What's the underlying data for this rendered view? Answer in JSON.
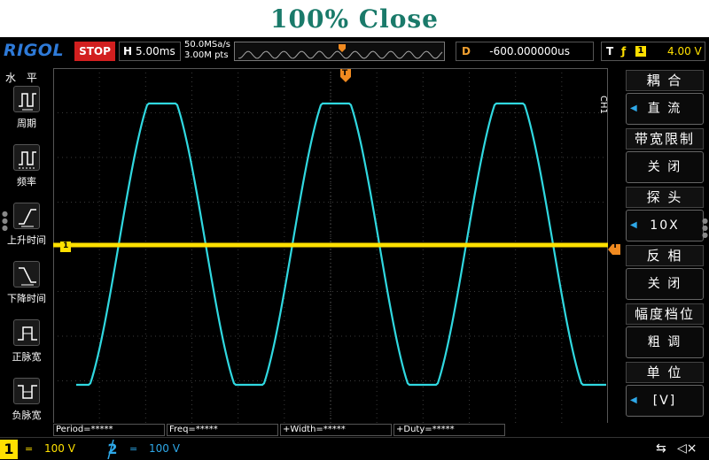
{
  "page": {
    "title": "100% Close"
  },
  "topbar": {
    "brand": "RIGOL",
    "run_state": "STOP",
    "timebase_tag": "H",
    "timebase": "5.00ms",
    "sample_rate": "50.0MSa/s",
    "memory_depth": "3.00M pts",
    "delay_tag": "D",
    "delay": "-600.000000us",
    "trigger_tag": "T",
    "trigger_edge": "ƒ",
    "trigger_source": "1",
    "trigger_level": "4.00 V"
  },
  "left_menu": {
    "title": "水 平",
    "items": [
      {
        "label": "周期",
        "icon": "period-icon"
      },
      {
        "label": "频率",
        "icon": "frequency-icon"
      },
      {
        "label": "上升时间",
        "icon": "rise-time-icon"
      },
      {
        "label": "下降时间",
        "icon": "fall-time-icon"
      },
      {
        "label": "正脉宽",
        "icon": "positive-width-icon"
      },
      {
        "label": "负脉宽",
        "icon": "negative-width-icon"
      }
    ]
  },
  "right_menu": {
    "channel_tag": "CH1",
    "sections": [
      {
        "header": "耦 合",
        "value": "直 流"
      },
      {
        "header": "带宽限制",
        "value": "关 闭"
      },
      {
        "header": "探 头",
        "value": "10X"
      },
      {
        "header": "反 相",
        "value": "关 闭"
      },
      {
        "header": "幅度档位",
        "value": "粗 调"
      },
      {
        "header": "单 位",
        "value": "[V]"
      }
    ]
  },
  "markers": {
    "trigger_position": "T",
    "channel1_marker": "1",
    "trigger_level_marker": "T"
  },
  "measurements": [
    {
      "label": "Period=*****"
    },
    {
      "label": "Freq=*****"
    },
    {
      "label": "+Width=*****"
    },
    {
      "label": "+Duty=*****"
    }
  ],
  "bottom": {
    "ch1_number": "1",
    "ch1_coupling": "=",
    "ch1_scale": "100 V",
    "ch2_number": "2",
    "ch2_coupling": "=",
    "ch2_scale": "100 V"
  },
  "colors": {
    "ch1": "#ffe000",
    "ch2": "#2ea8e8",
    "trace": "#30d8e0",
    "stop": "#d21f1f",
    "trigger_marker": "#f08a20",
    "title": "#1a7a6a"
  }
}
